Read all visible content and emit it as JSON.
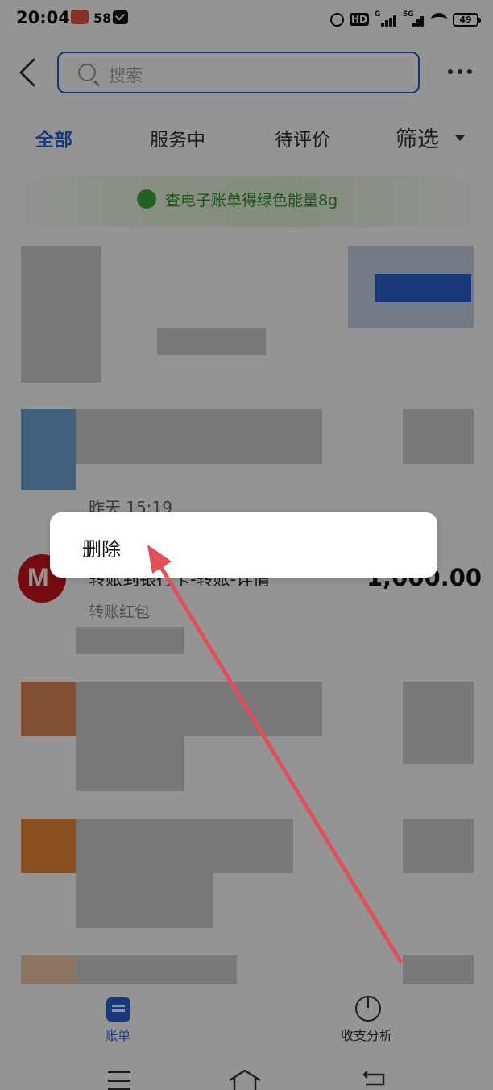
{
  "status_bar": {
    "time": "20:04",
    "notif_count": "58",
    "hd": "HD",
    "sig1_label": "G",
    "sig2_label": "5G",
    "battery": "49"
  },
  "header": {
    "search_placeholder": "搜索"
  },
  "tabs": [
    {
      "label": "全部",
      "active": true
    },
    {
      "label": "服务中",
      "active": false
    },
    {
      "label": "待评价",
      "active": false
    },
    {
      "label": "筛选",
      "active": false
    }
  ],
  "energy_banner": {
    "text": "查电子账单得绿色能量8g"
  },
  "transaction": {
    "date": "昨天  15:19",
    "title": "转账到银行卡-转账-详情",
    "amount": "1,000.00",
    "subtitle": "转账红包"
  },
  "popup": {
    "delete_label": "删除"
  },
  "bottom_nav": {
    "bill_label": "账单",
    "analysis_label": "收支分析"
  },
  "colors": {
    "accent": "#2a62d0",
    "arrow": "#e0505a",
    "energy_green": "#3b8e31"
  }
}
